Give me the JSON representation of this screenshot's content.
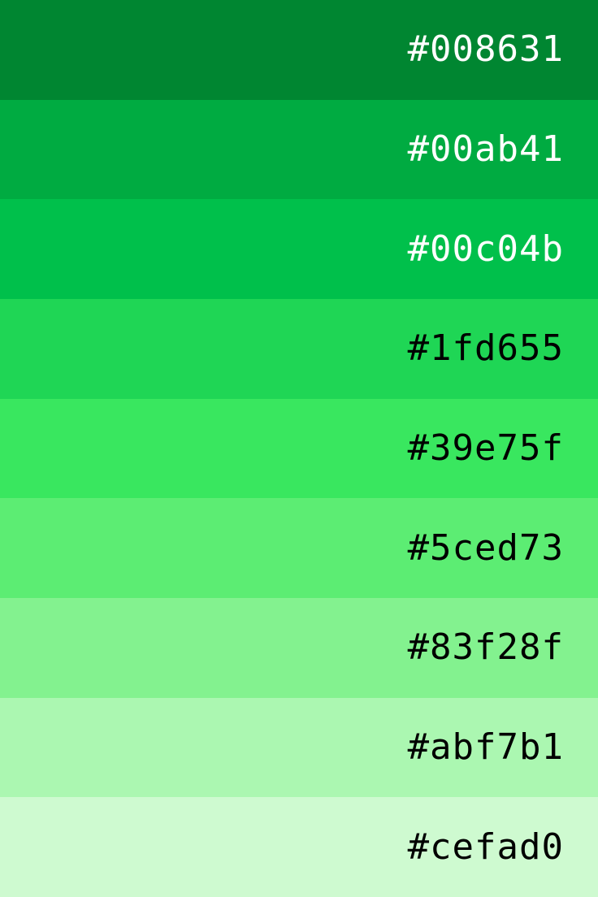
{
  "swatches": [
    {
      "hex": "#008631",
      "label": "#008631",
      "text_color": "#ffffff"
    },
    {
      "hex": "#00ab41",
      "label": "#00ab41",
      "text_color": "#ffffff"
    },
    {
      "hex": "#00c04b",
      "label": "#00c04b",
      "text_color": "#ffffff"
    },
    {
      "hex": "#1fd655",
      "label": "#1fd655",
      "text_color": "#000000"
    },
    {
      "hex": "#39e75f",
      "label": "#39e75f",
      "text_color": "#000000"
    },
    {
      "hex": "#5ced73",
      "label": "#5ced73",
      "text_color": "#000000"
    },
    {
      "hex": "#83f28f",
      "label": "#83f28f",
      "text_color": "#000000"
    },
    {
      "hex": "#abf7b1",
      "label": "#abf7b1",
      "text_color": "#000000"
    },
    {
      "hex": "#cefad0",
      "label": "#cefad0",
      "text_color": "#000000"
    }
  ]
}
